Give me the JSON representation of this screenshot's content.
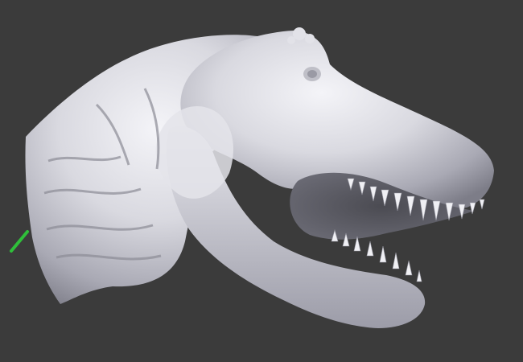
{
  "viewport": {
    "background": "#3b3b3b",
    "model": {
      "name": "dinosaur-head-sculpt",
      "material_color": "#d6d6dc",
      "shadow_color": "#8a8a94"
    },
    "axis_gizmo": {
      "color": "#2fbf3a",
      "icon": "axis-gizmo-icon"
    }
  }
}
